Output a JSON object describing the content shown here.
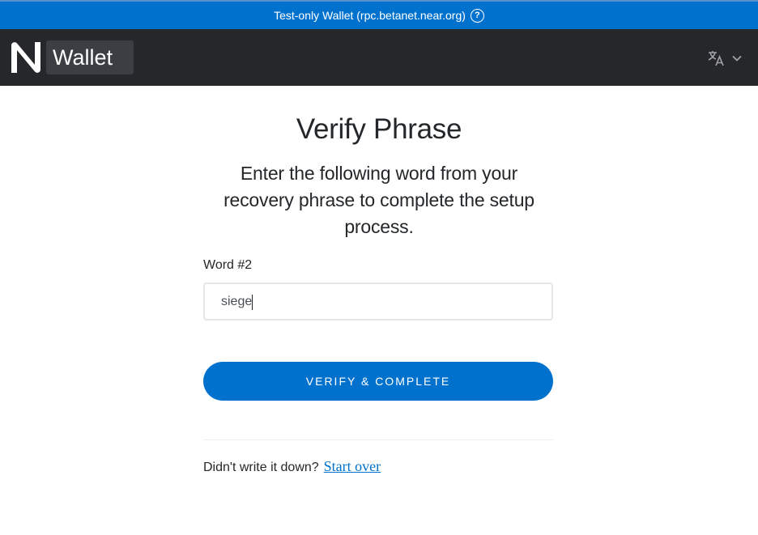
{
  "banner": {
    "text": "Test-only Wallet (rpc.betanet.near.org)",
    "help_icon": "question-circle-icon"
  },
  "navbar": {
    "logo_text": "Wallet",
    "logo_icon": "near-logo-icon",
    "language_icon": "translate-icon",
    "dropdown_icon": "chevron-down-icon"
  },
  "page": {
    "title": "Verify Phrase",
    "subtitle": "Enter the following word from your recovery phrase to complete the setup process."
  },
  "form": {
    "label": "Word #2",
    "value": "siege",
    "submit_label": "VERIFY & COMPLETE"
  },
  "footer": {
    "prompt": "Didn't write it down?",
    "link": "Start over"
  },
  "colors": {
    "banner": "#0072ce",
    "navbar": "#25272a",
    "button": "#0072ce",
    "link": "#0072ce"
  }
}
